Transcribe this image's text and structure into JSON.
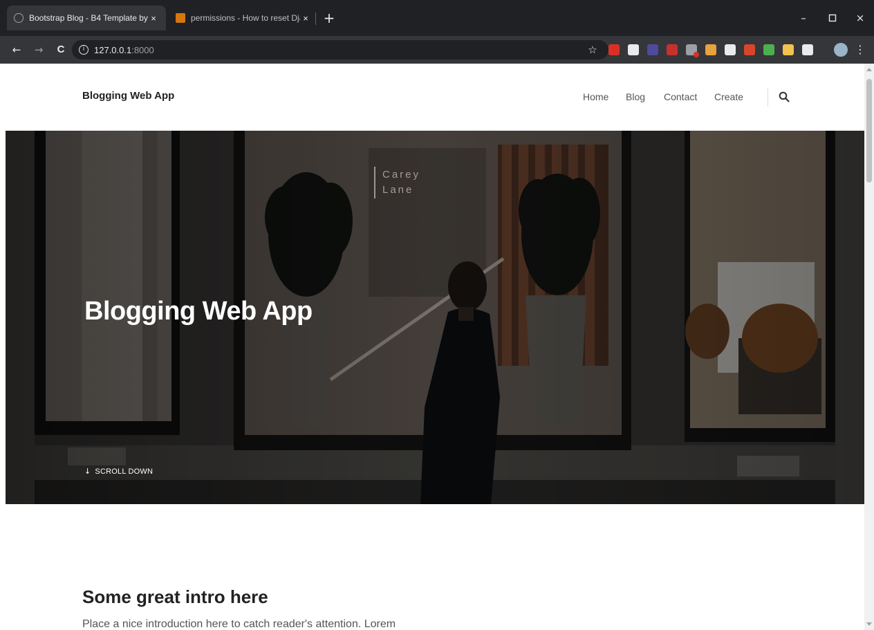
{
  "browser": {
    "tabs": [
      {
        "title": "Bootstrap Blog - B4 Template by",
        "close": "×",
        "active": true
      },
      {
        "title": "permissions - How to reset Djan",
        "close": "×",
        "active": false
      }
    ],
    "new_tab": "+",
    "window_controls": {
      "minimize": "–",
      "maximize": "▫",
      "close": "×"
    },
    "nav": {
      "back": "←",
      "forward": "→",
      "reload": "C"
    },
    "address": {
      "host": "127.0.0.1",
      "port": ":8000",
      "info": "i"
    },
    "bookmark": "☆",
    "menu": "⋮",
    "extension_colors": [
      "#d93025",
      "#e8eaed",
      "#4f4a9c",
      "#c9302c",
      "#9aa0a6",
      "#e6a33d",
      "#e8eaed",
      "#d9452b",
      "#4caf50",
      "#f2c14e",
      "#e8eaed"
    ]
  },
  "site": {
    "brand": "Blogging Web App",
    "nav": [
      "Home",
      "Blog",
      "Contact",
      "Create"
    ],
    "hero": {
      "title": "Blogging Web App",
      "scroll_label": "SCROLL DOWN",
      "scroll_arrow": "↓",
      "window_sign": [
        "Carey",
        "Lane"
      ]
    },
    "intro": {
      "title": "Some great intro here",
      "text": "Place a nice introduction here to catch reader's attention. Lorem"
    }
  },
  "colors": {
    "chrome_dark": "#202124",
    "chrome_toolbar": "#35363a",
    "hero_text": "#ffffff",
    "heading": "#222222"
  }
}
